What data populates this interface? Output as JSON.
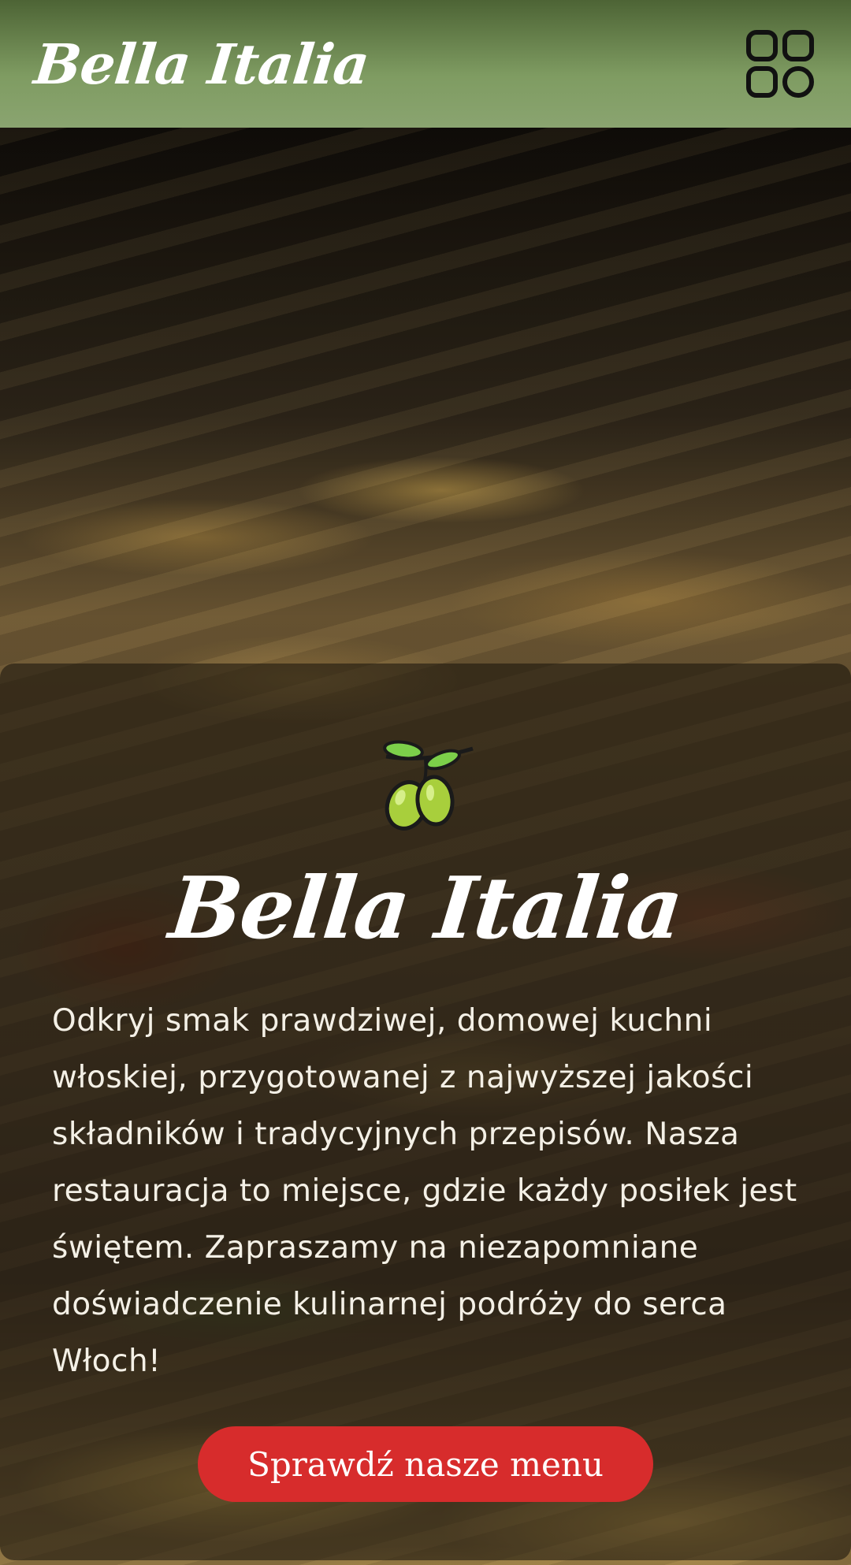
{
  "header": {
    "logo": "Bella Italia",
    "menu_icon": "grid-menu-icon"
  },
  "hero": {
    "title": "Bella Italia",
    "description": "Odkryj smak prawdziwej, domowej kuchni włoskiej, przygotowanej z najwyższej jakości składników i tradycyjnych przepisów. Nasza restauracja to miejsce, gdzie każdy posiłek jest świętem. Zapraszamy na niezapomniane doświadczenie kulinarnej podróży do serca Włoch!",
    "cta_label": "Sprawdź nasze menu",
    "icon": "olive-branch-icon"
  },
  "colors": {
    "header_top": "#4d6435",
    "header_bottom": "#8aa470",
    "cta": "#d72c2c",
    "olive": "#9ccc45"
  }
}
